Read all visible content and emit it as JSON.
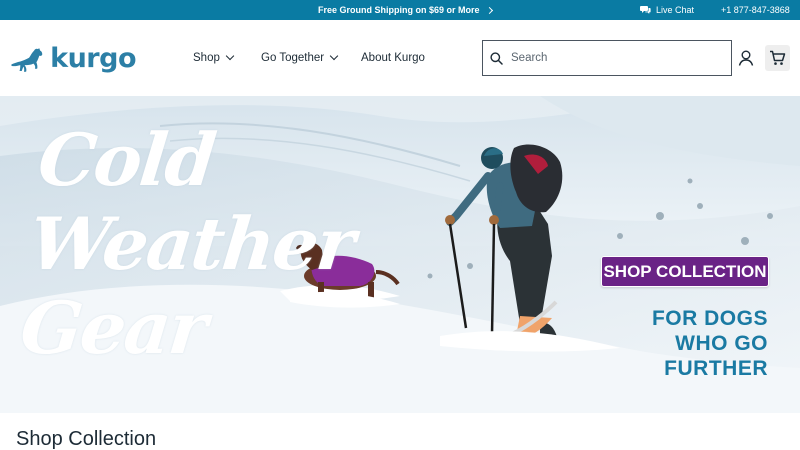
{
  "topbar": {
    "promo_text": "Free Ground Shipping on $69 or More",
    "live_chat": "Live Chat",
    "phone": "+1 877-847-3868"
  },
  "header": {
    "logo_text": "kurgo",
    "nav": [
      {
        "label": "Shop",
        "has_dropdown": true
      },
      {
        "label": "Go Together",
        "has_dropdown": true
      },
      {
        "label": "About Kurgo",
        "has_dropdown": false
      }
    ],
    "search": {
      "placeholder": "Search",
      "value": ""
    },
    "icons": {
      "search": "search-icon",
      "account": "account-icon",
      "cart": "cart-icon"
    }
  },
  "hero": {
    "title_lines": [
      "Cold",
      "Weather",
      "Gear"
    ],
    "cta_label": "SHOP COLLECTION",
    "tagline_lines": [
      "FOR DOGS",
      "WHO GO",
      "FURTHER"
    ]
  },
  "section": {
    "title": "Shop Collection"
  },
  "colors": {
    "topbar_bg": "#0a7ba3",
    "brand_blue": "#2c7fa6",
    "cta_bg": "#6a2386",
    "tagline": "#1a7aa3"
  }
}
